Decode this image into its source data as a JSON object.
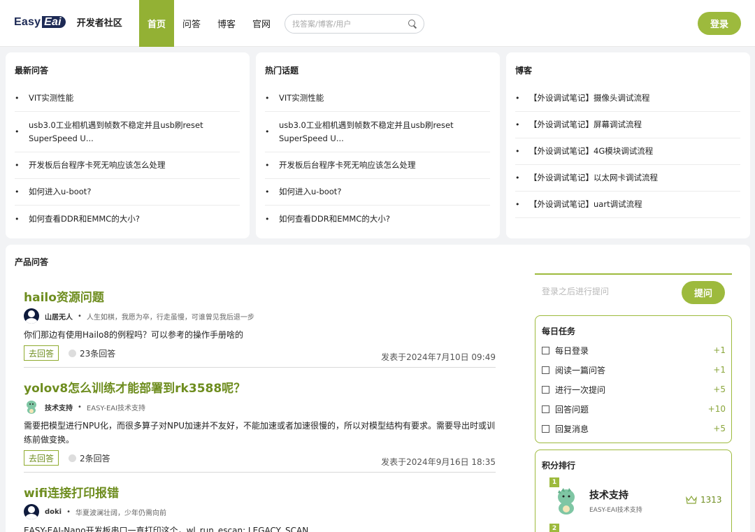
{
  "header": {
    "logo": {
      "part1": "Easy",
      "part2": "Eai"
    },
    "site_name": "开发者社区",
    "nav": [
      "首页",
      "问答",
      "博客",
      "官网"
    ],
    "search_placeholder": "找答案/博客/用户",
    "login_label": "登录"
  },
  "cards": [
    {
      "title": "最新问答",
      "items": [
        "VIT实测性能",
        "usb3.0工业相机遇到帧数不稳定并且usb刷reset SuperSpeed U...",
        "开发板后台程序卡死无响应该怎么处理",
        "如何进入u-boot?",
        "如何查看DDR和EMMC的大小?"
      ]
    },
    {
      "title": "热门话题",
      "items": [
        "VIT实测性能",
        "usb3.0工业相机遇到帧数不稳定并且usb刷reset SuperSpeed U...",
        "开发板后台程序卡死无响应该怎么处理",
        "如何进入u-boot?",
        "如何查看DDR和EMMC的大小?"
      ]
    },
    {
      "title": "博客",
      "items": [
        "【外设调试笔记】摄像头调试流程",
        "【外设调试笔记】屏幕调试流程",
        "【外设调试笔记】4G模块调试流程",
        "【外设调试笔记】以太网卡调试流程",
        "【外设调试笔记】uart调试流程"
      ]
    }
  ],
  "main": {
    "title": "产品问答",
    "questions": [
      {
        "title": "hailo资源问题",
        "author": "山居无人",
        "motto": "人生如棋，我愿为卒，行走虽慢，可谁曾见我后退一步",
        "body": "你们那边有使用Hailo8的例程吗？可以参考的操作手册啥的",
        "go": "去回答",
        "answers": "23条回答",
        "date": "发表于2024年7月10日 09:49"
      },
      {
        "title": "yolov8怎么训练才能部署到rk3588呢？",
        "author": "技术支持",
        "motto": "EASY-EAI技术支持",
        "body": "需要把模型进行NPU化，而很多算子对NPU加速并不友好，不能加速或者加速很慢的，所以对模型结构有要求。需要导出时或训练前做变换。",
        "go": "去回答",
        "answers": "2条回答",
        "date": "发表于2024年9月16日 18:35"
      },
      {
        "title": "wifi连接打印报错",
        "author": "doki",
        "motto": "华夏波澜壮阔，少年仍需向前",
        "body": "EASY-EAI-Nano开发板串口一直打印这个，wl_run_escan: LEGACY_SCAN"
      }
    ]
  },
  "sidebar": {
    "ask_placeholder": "登录之后进行提问",
    "ask_label": "提问",
    "daily": {
      "title": "每日任务",
      "tasks": [
        {
          "label": "每日登录",
          "pts": "+1"
        },
        {
          "label": "阅读一篇问答",
          "pts": "+1"
        },
        {
          "label": "进行一次提问",
          "pts": "+5"
        },
        {
          "label": "回答问题",
          "pts": "+10"
        },
        {
          "label": "回复消息",
          "pts": "+5"
        }
      ]
    },
    "ranking": {
      "title": "积分排行",
      "entries": [
        {
          "rank": "1",
          "name": "技术支持",
          "sub": "EASY-EAI技术支持",
          "score": "1313"
        },
        {
          "rank": "2"
        }
      ]
    }
  },
  "colors": {
    "accent": "#9dba3d",
    "accent_dark": "#6e8d1f",
    "logo_navy": "#1d2a55"
  }
}
